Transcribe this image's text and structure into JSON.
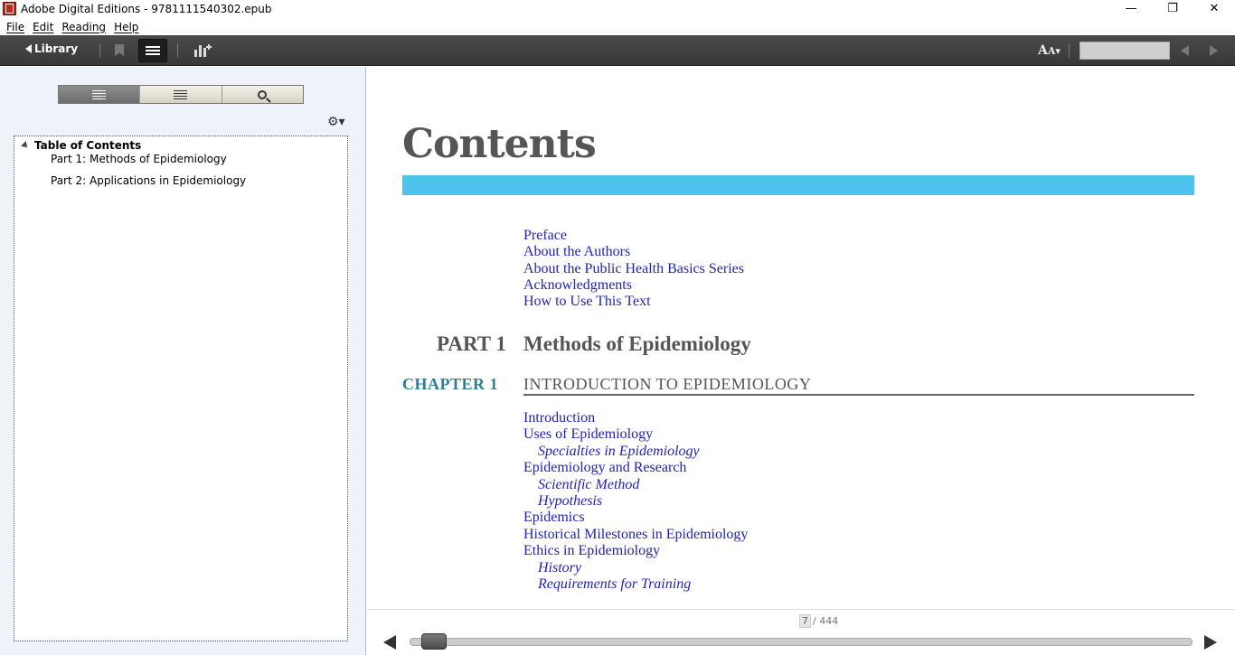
{
  "window": {
    "title": "Adobe Digital Editions - 9781111540302.epub",
    "minimize": "—",
    "restore": "❐",
    "close": "✕"
  },
  "menu": [
    "File",
    "Edit",
    "Reading",
    "Help"
  ],
  "toolbar": {
    "library_label": "Library",
    "font_size_label": "A",
    "font_size_label_small": "A"
  },
  "sidebar": {
    "gear_label": "⚙▾",
    "toc_root": "Table of Contents",
    "toc_items": [
      "Part 1: Methods of Epidemiology",
      "Part 2: Applications in Epidemiology"
    ]
  },
  "content": {
    "heading": "Contents",
    "front_matter": [
      "Preface",
      "About the Authors",
      "About the Public Health Basics Series",
      "Acknowledgments",
      "How to Use This Text"
    ],
    "part_label": "PART 1",
    "part_title": "Methods of Epidemiology",
    "chapter_label": "CHAPTER 1",
    "chapter_title": "INTRODUCTION TO EPIDEMIOLOGY",
    "chapter_entries": [
      {
        "text": "Introduction",
        "sub": false
      },
      {
        "text": "Uses of Epidemiology",
        "sub": false
      },
      {
        "text": "Specialties in Epidemiology",
        "sub": true
      },
      {
        "text": "Epidemiology and Research",
        "sub": false
      },
      {
        "text": "Scientific Method",
        "sub": true
      },
      {
        "text": "Hypothesis",
        "sub": true
      },
      {
        "text": "Epidemics",
        "sub": false
      },
      {
        "text": "Historical Milestones in Epidemiology",
        "sub": false
      },
      {
        "text": "Ethics in Epidemiology",
        "sub": false
      },
      {
        "text": "History",
        "sub": true
      },
      {
        "text": "Requirements for Training",
        "sub": true
      }
    ]
  },
  "pager": {
    "current_page": "7",
    "total_pages": "/ 444",
    "progress_fraction": 0.016
  },
  "colors": {
    "accent_rule": "#4dc3ee",
    "chapter_label": "#2a7f9a",
    "link": "#2222bb"
  }
}
